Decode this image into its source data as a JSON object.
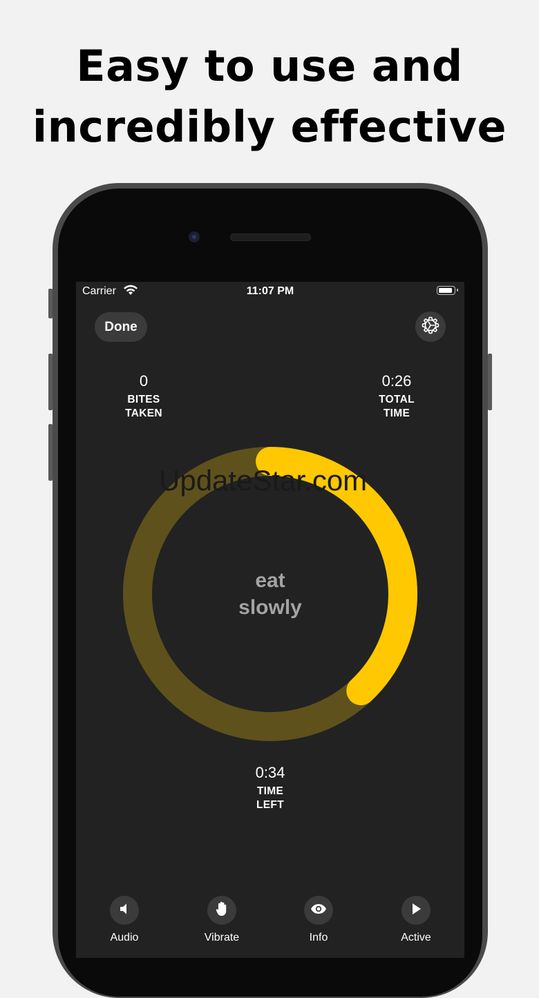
{
  "headline": {
    "line1": "Easy to use and",
    "line2": "incredibly effective"
  },
  "status_bar": {
    "carrier": "Carrier",
    "time": "11:07 PM",
    "wifi_icon": "wifi-icon",
    "battery_icon": "battery-icon"
  },
  "header": {
    "done_label": "Done",
    "settings_icon": "gear-icon"
  },
  "stats": {
    "bites": {
      "value": "0",
      "label_line1": "BITES",
      "label_line2": "TAKEN"
    },
    "total_time": {
      "value": "0:26",
      "label_line1": "TOTAL",
      "label_line2": "TIME"
    },
    "time_left": {
      "value": "0:34",
      "label_line1": "TIME",
      "label_line2": "LEFT"
    }
  },
  "timer_ring": {
    "progress_fraction": 0.38,
    "track_color": "#5e511c",
    "progress_color": "#ffc800",
    "center_line1": "eat",
    "center_line2": "slowly"
  },
  "watermark": "UpdateStar.com",
  "toolbar": [
    {
      "label": "Audio",
      "icon": "speaker-icon"
    },
    {
      "label": "Vibrate",
      "icon": "hand-icon"
    },
    {
      "label": "Info",
      "icon": "eye-icon"
    },
    {
      "label": "Active",
      "icon": "play-icon"
    }
  ],
  "colors": {
    "screen_background": "#222222",
    "button_background": "#3b3b3b",
    "page_background": "#f2f2f2"
  }
}
